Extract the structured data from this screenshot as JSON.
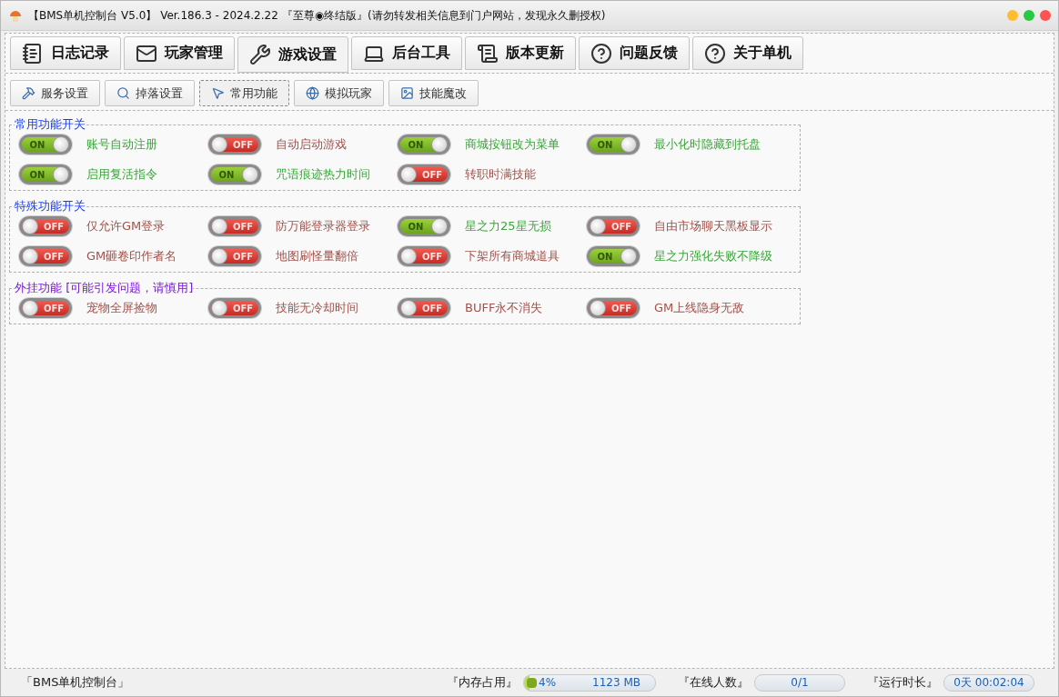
{
  "window": {
    "title": "【BMS单机控制台 V5.0】 Ver.186.3 - 2024.2.22 『至尊◉终结版』(请勿转发相关信息到门户网站，发现永久删授权)"
  },
  "tabs": [
    {
      "label": "日志记录",
      "selected": false
    },
    {
      "label": "玩家管理",
      "selected": false
    },
    {
      "label": "游戏设置",
      "selected": true
    },
    {
      "label": "后台工具",
      "selected": false
    },
    {
      "label": "版本更新",
      "selected": false
    },
    {
      "label": "问题反馈",
      "selected": false
    },
    {
      "label": "关于单机",
      "selected": false
    }
  ],
  "subtabs": [
    {
      "label": "服务设置",
      "selected": false
    },
    {
      "label": "掉落设置",
      "selected": false
    },
    {
      "label": "常用功能",
      "selected": true
    },
    {
      "label": "模拟玩家",
      "selected": false
    },
    {
      "label": "技能魔改",
      "selected": false
    }
  ],
  "groups": [
    {
      "title": "常用功能开关",
      "color": "#1a3cf0",
      "items": [
        {
          "label": "账号自动注册",
          "on": true,
          "switch_text": "ON"
        },
        {
          "label": "自动启动游戏",
          "on": false,
          "switch_text": "OFF"
        },
        {
          "label": "商城按钮改为菜单",
          "on": true,
          "switch_text": "ON"
        },
        {
          "label": "最小化时隐藏到托盘",
          "on": true,
          "switch_text": "ON"
        },
        {
          "label": "启用复活指令",
          "on": true,
          "switch_text": "ON"
        },
        {
          "label": "咒语痕迹热力时间",
          "on": true,
          "switch_text": "ON"
        },
        {
          "label": "转职时满技能",
          "on": false,
          "switch_text": "OFF"
        }
      ]
    },
    {
      "title": "特殊功能开关",
      "color": "#1a3cf0",
      "items": [
        {
          "label": "仅允许GM登录",
          "on": false,
          "switch_text": "OFF"
        },
        {
          "label": "防万能登录器登录",
          "on": false,
          "switch_text": "OFF"
        },
        {
          "label": "星之力25星无损",
          "on": true,
          "switch_text": "ON"
        },
        {
          "label": "自由市场聊天黑板显示",
          "on": false,
          "switch_text": "OFF"
        },
        {
          "label": "GM砸卷印作者名",
          "on": false,
          "switch_text": "OFF"
        },
        {
          "label": "地图刷怪量翻倍",
          "on": false,
          "switch_text": "OFF"
        },
        {
          "label": "下架所有商城道具",
          "on": false,
          "switch_text": "OFF"
        },
        {
          "label": "星之力强化失败不降级",
          "on": true,
          "switch_text": "ON"
        }
      ]
    },
    {
      "title": "外挂功能 [可能引发问题，请慎用]",
      "color": "#7b16e0",
      "items": [
        {
          "label": "宠物全屏捡物",
          "on": false,
          "switch_text": "OFF"
        },
        {
          "label": "技能无冷却时间",
          "on": false,
          "switch_text": "OFF"
        },
        {
          "label": "BUFF永不消失",
          "on": false,
          "switch_text": "OFF"
        },
        {
          "label": "GM上线隐身无敌",
          "on": false,
          "switch_text": "OFF"
        }
      ]
    }
  ],
  "status_bar": {
    "app_name": "「BMS单机控制台」",
    "memory": {
      "label": "『内存占用』",
      "percent": "4%",
      "size": "1123 MB",
      "level": 0.04
    },
    "online": {
      "label": "『在线人数』",
      "value": "0/1"
    },
    "runtime": {
      "label": "『运行时长』",
      "value": "0天 00:02:04"
    }
  }
}
